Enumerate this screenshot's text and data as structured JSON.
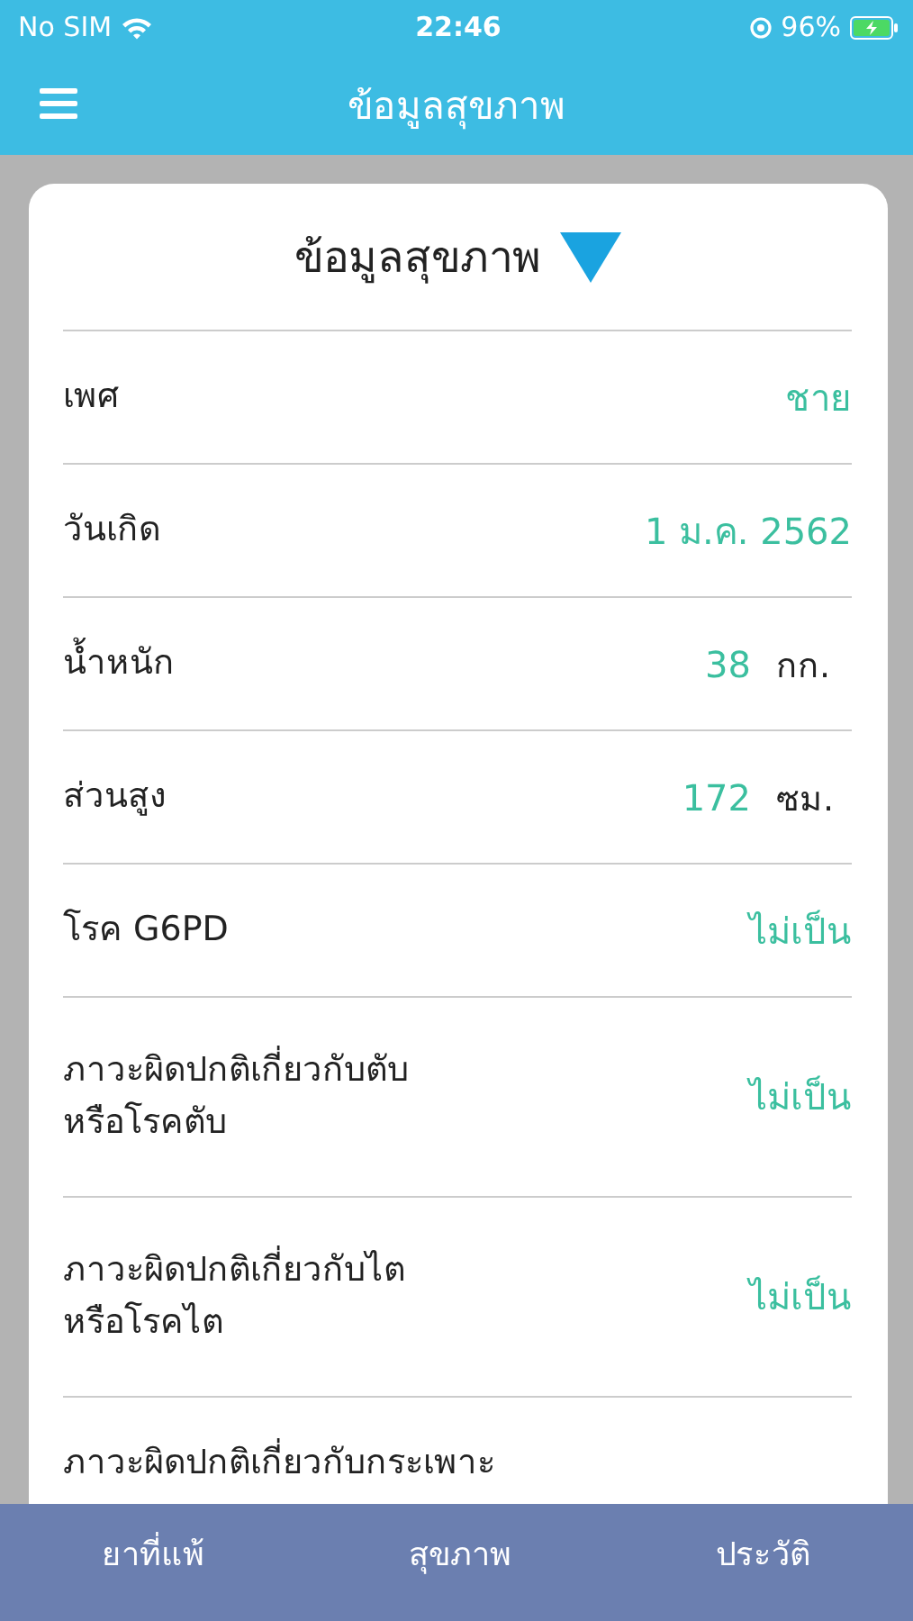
{
  "status_bar": {
    "carrier": "No SIM",
    "time": "22:46",
    "battery": "96%"
  },
  "header": {
    "title": "ข้อมูลสุขภาพ"
  },
  "card": {
    "title": "ข้อมูลสุขภาพ",
    "expanded": true,
    "rows": [
      {
        "label": "เพศ",
        "value": "ชาย"
      },
      {
        "label": "วันเกิด",
        "value": "1 ม.ค. 2562"
      },
      {
        "label": "น้ำหนัก",
        "value": "38",
        "unit": "กก."
      },
      {
        "label": "ส่วนสูง",
        "value": "172",
        "unit": "ซม."
      },
      {
        "label": "โรค G6PD",
        "value": "ไม่เป็น"
      },
      {
        "label": "ภาวะผิดปกติเกี่ยวกับตับ\nหรือโรคตับ",
        "value": "ไม่เป็น"
      },
      {
        "label": "ภาวะผิดปกติเกี่ยวกับไต\nหรือโรคไต",
        "value": "ไม่เป็น"
      },
      {
        "label": "ภาวะผิดปกติเกี่ยวกับกระเพาะ"
      }
    ]
  },
  "tabs": [
    {
      "label": "ยาที่แพ้"
    },
    {
      "label": "สุขภาพ"
    },
    {
      "label": "ประวัติ"
    }
  ]
}
